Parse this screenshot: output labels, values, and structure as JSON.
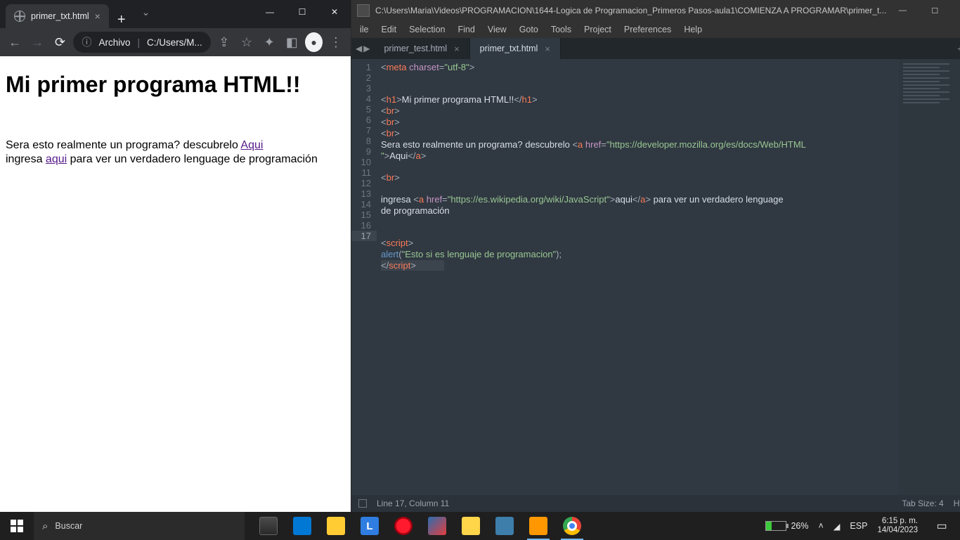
{
  "chrome": {
    "tab_title": "primer_txt.html",
    "omni_label": "Archivo",
    "omni_path": "C:/Users/M...",
    "page": {
      "h1": "Mi primer programa HTML!!",
      "p1_before": "Sera esto realmente un programa? descubrelo ",
      "p1_link": "Aqui",
      "p2_before": "ingresa ",
      "p2_link": "aqui",
      "p2_after": " para ver un verdadero lenguage de programación"
    }
  },
  "sublime": {
    "title": "C:\\Users\\Maria\\Videos\\PROGRAMACION\\1644-Logica de Programacion_Primeros Pasos-aula1\\COMIENZA A PROGRAMAR\\primer_t...",
    "menu": [
      "ile",
      "Edit",
      "Selection",
      "Find",
      "View",
      "Goto",
      "Tools",
      "Project",
      "Preferences",
      "Help"
    ],
    "tabs": [
      {
        "label": "primer_test.html",
        "active": false
      },
      {
        "label": "primer_txt.html",
        "active": true
      }
    ],
    "status_left": "Line 17, Column 11",
    "status_tab": "Tab Size: 4",
    "status_lang": "HTML",
    "gutter": [
      "1",
      "2",
      "3",
      "4",
      "5",
      "6",
      "7",
      "8",
      "",
      "9",
      "10",
      "11",
      "12",
      "",
      "13",
      "14",
      "15",
      "16",
      "17"
    ],
    "code": {
      "l1": {
        "tag_open": "<",
        "meta": "meta",
        "sp": " ",
        "attr": "charset",
        "eq": "=",
        "val": "\"utf-8\"",
        "tag_close": ">"
      },
      "l4": {
        "o": "<",
        "h1": "h1",
        "c": ">",
        "txt": "Mi primer programa HTML!!",
        "o2": "</",
        "h1b": "h1",
        "c2": ">"
      },
      "br": {
        "o": "<",
        "br": "br",
        "c": ">"
      },
      "l8a": {
        "pre": "Sera esto realmente un programa? descubrelo ",
        "o": "<",
        "a": "a",
        "sp": " ",
        "href": "href",
        "eq": "=",
        "url": "\"https://developer.mozilla.org/es/docs/Web/HTML"
      },
      "l8b": {
        "urlend": "\"",
        "c": ">",
        "txt": "Aqui",
        "o2": "</",
        "a": "a",
        "c2": ">"
      },
      "l12a": {
        "pre": "ingresa ",
        "o": "<",
        "a": "a",
        "sp": " ",
        "href": "href",
        "eq": "=",
        "url": "\"https://es.wikipedia.org/wiki/JavaScript\"",
        "c": ">",
        "txt": "aqui",
        "o2": "</",
        "a2": "a",
        "c2": ">",
        "post": " para ver un verdadero lenguage"
      },
      "l12b": {
        "txt": "de programación"
      },
      "l15": {
        "o": "<",
        "s": "script",
        "c": ">"
      },
      "l16": {
        "fn": "alert",
        "op": "(",
        "str": "\"Esto si es lenguaje de programacion\"",
        "cp": ");"
      },
      "l17": {
        "o": "</",
        "s": "script",
        "c": ">"
      }
    }
  },
  "taskbar": {
    "search_placeholder": "Buscar",
    "battery_pct": "26%",
    "lang": "ESP",
    "time": "6:15 p. m.",
    "date": "14/04/2023"
  }
}
